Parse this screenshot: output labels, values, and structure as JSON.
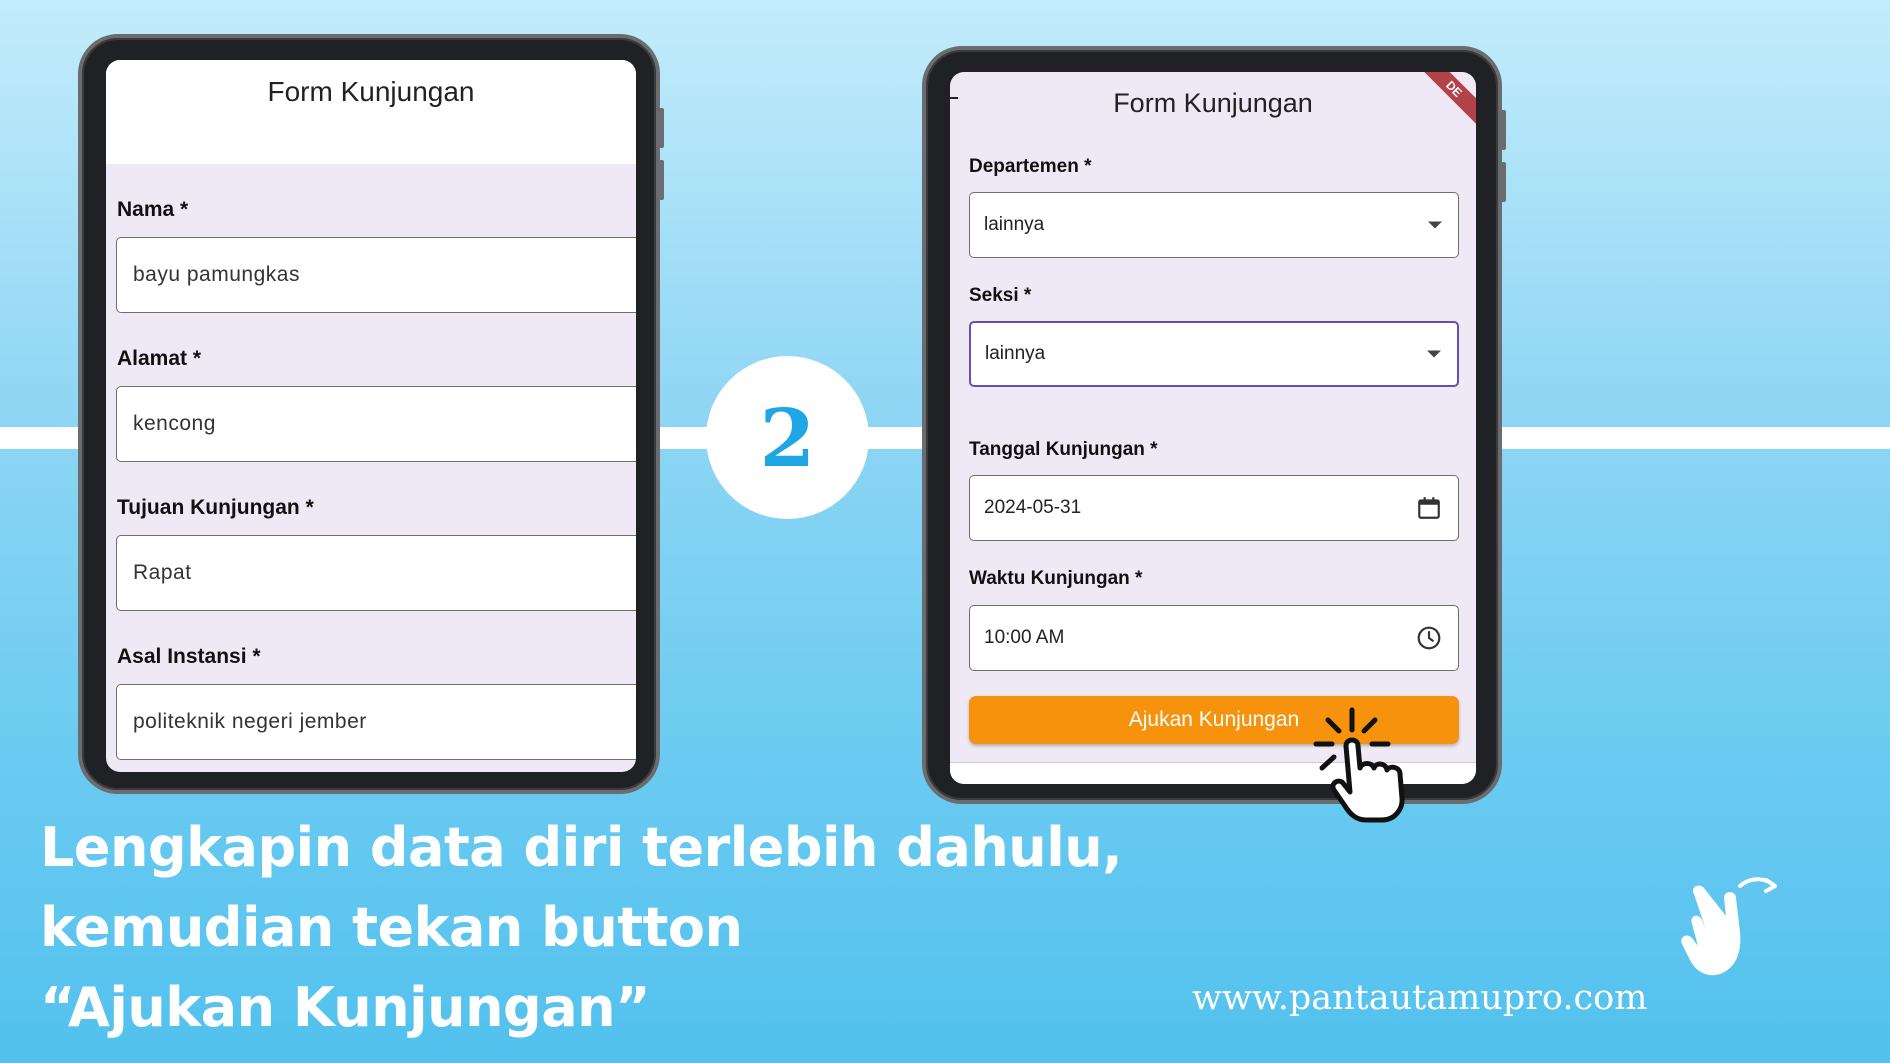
{
  "step_number": "2",
  "left_form": {
    "title": "Form Kunjungan",
    "fields": [
      {
        "label": "Nama *",
        "value": "bayu pamungkas"
      },
      {
        "label": "Alamat *",
        "value": "kencong"
      },
      {
        "label": "Tujuan Kunjungan *",
        "value": "Rapat"
      },
      {
        "label": "Asal Instansi *",
        "value": "politeknik negeri jember"
      }
    ]
  },
  "right_form": {
    "title": "Form Kunjungan",
    "departemen": {
      "label": "Departemen *",
      "value": "lainnya"
    },
    "seksi": {
      "label": "Seksi *",
      "value": "lainnya"
    },
    "tanggal": {
      "label": "Tanggal Kunjungan *",
      "value": "2024-05-31"
    },
    "waktu": {
      "label": "Waktu Kunjungan *",
      "value": "10:00 AM"
    },
    "submit_label": "Ajukan Kunjungan",
    "debug_banner": "DE"
  },
  "caption": {
    "line1": "Lengkapin data diri terlebih dahulu,",
    "line2": "kemudian tekan button",
    "line3": "“Ajukan Kunjungan”"
  },
  "website": "www.pantautamupro.com",
  "colors": {
    "accent_orange": "#f7920d",
    "step_blue": "#1ea7e4",
    "focus_purple": "#6a4db0"
  },
  "icons": [
    "calendar-icon",
    "clock-icon",
    "dropdown-caret-icon",
    "tap-hand-icon",
    "swipe-hand-icon"
  ]
}
